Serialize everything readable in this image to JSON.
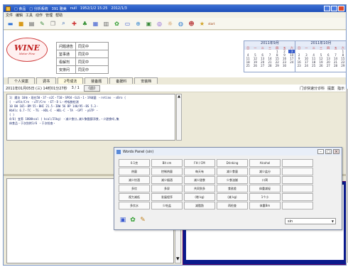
{
  "window": {
    "title_parts": [
      "□ 食品",
      "□ 分析系统",
      "391 雅美",
      "null",
      "1952/1/2 15:25",
      "2012/1/3"
    ]
  },
  "menu": [
    "文件",
    "编辑",
    "工具",
    "动作",
    "管理",
    "帮助"
  ],
  "toolbar": {
    "icons": [
      {
        "name": "open-icon",
        "glyph": "▬",
        "color": "#2b6fd6"
      },
      {
        "name": "save-icon",
        "glyph": "■",
        "color": "#d89a1a"
      },
      {
        "name": "print-icon",
        "glyph": "▤",
        "color": "#555555"
      },
      {
        "name": "edit-icon",
        "glyph": "✎",
        "color": "#3a8a3a"
      },
      {
        "name": "copy-icon",
        "glyph": "❐",
        "color": "#7a7a7a"
      },
      {
        "name": "search-icon",
        "glyph": "⌕",
        "color": "#2b5fb0"
      },
      {
        "name": "tools-icon",
        "glyph": "✚",
        "color": "#c33"
      },
      {
        "name": "bell-icon",
        "glyph": "♣",
        "color": "#2a8a2a"
      },
      {
        "name": "calendar-icon",
        "glyph": "▦",
        "color": "#3a5ad0"
      },
      {
        "name": "chart-icon",
        "glyph": "▥",
        "color": "#6a6a6a"
      },
      {
        "name": "flower-icon",
        "glyph": "✿",
        "color": "#2a9a2a"
      },
      {
        "name": "card-icon",
        "glyph": "▭",
        "color": "#3a5ad0"
      },
      {
        "name": "zoom-icon",
        "glyph": "⊕",
        "color": "#3a8ad0"
      },
      {
        "name": "image-icon",
        "glyph": "▣",
        "color": "#3a8a3a"
      },
      {
        "name": "cd-icon",
        "glyph": "◎",
        "color": "#7a4ad0"
      },
      {
        "name": "drum-icon",
        "glyph": "☼",
        "color": "#c07020"
      },
      {
        "name": "web-icon",
        "glyph": "◍",
        "color": "#2a7ad0"
      },
      {
        "name": "user-icon",
        "glyph": "☻",
        "color": "#c05050"
      },
      {
        "name": "start-icon",
        "glyph": "★",
        "color": "#d0a020"
      }
    ],
    "start_label": "start"
  },
  "logo": {
    "text": "WINE",
    "subtitle": "Meter Fine"
  },
  "info_grid": [
    {
      "label": "问题通告",
      "value": "同见中"
    },
    {
      "label": "鉴事通",
      "value": "同见中"
    },
    {
      "label": "看解剂",
      "value": "同见中"
    },
    {
      "label": "安排问",
      "value": "同见中"
    }
  ],
  "calendars": [
    {
      "title": "2011年9月",
      "dow": [
        "日",
        "一",
        "二",
        "三",
        "四",
        "五",
        "六"
      ],
      "days": [
        "",
        "",
        "",
        "",
        "1",
        "2",
        "3",
        "4",
        "5",
        "6",
        "7",
        "8",
        "9",
        "10",
        "11",
        "12",
        "13",
        "14",
        "15",
        "16",
        "17",
        "18",
        "19",
        "20",
        "21",
        "22",
        "23",
        "24",
        "25",
        "26",
        "27",
        "28",
        "29",
        "30",
        ""
      ],
      "selected": "3"
    },
    {
      "title": "2011年10月",
      "dow": [
        "日",
        "一",
        "二",
        "三",
        "四",
        "五",
        "六"
      ],
      "days": [
        "",
        "",
        "",
        "",
        "",
        "",
        "1",
        "2",
        "3",
        "4",
        "5",
        "6",
        "7",
        "8",
        "9",
        "10",
        "11",
        "12",
        "13",
        "14",
        "15",
        "16",
        "17",
        "18",
        "19",
        "20",
        "21",
        "22",
        "23",
        "24",
        "25",
        "26",
        "27",
        "28",
        "29"
      ],
      "selected": ""
    }
  ],
  "tabs": [
    {
      "label": "个人资案",
      "active": false
    },
    {
      "label": "调书",
      "active": false
    },
    {
      "label": "2号成法",
      "active": true
    },
    {
      "label": "装备题",
      "active": false
    },
    {
      "label": "备援料",
      "active": false
    },
    {
      "label": "安装档",
      "active": false
    }
  ],
  "datebar": {
    "date": "2011年01月05日 (三) 14时01分27秒",
    "page": "3 / 1",
    "nav_button": "《前》",
    "right_items": [
      "门诊快速分诊科",
      "提案",
      "指示"
    ]
  },
  "record_lines": [
    "1) 遭访 10年・现在50・37・o2C・T10・SPO4・GLS・1・19球菌 ・retino    ・sBro (",
    "( ・uAlk/Cre    ・uTF/Cre    ・ET・D L・呼吸数检测",
    "10 BH   165・BM   55・BHI    21.5・IBW    56 BP    140/95・BS 5.3・",
    "HbAlc 6.7・TC    ・TG   ・HDL-C    ・HDL-C    ・TA    ・GPT    ・yGTP    ・",
    "(   )",
    "4/6) 宜养    1800kcal (    kcal/25kg) ・减少食分,减少聚酯醇添食,・少甜食吗,集",
    "体食品・于次别附1/6    ・于次检查・"
  ],
  "words_panel": {
    "title": "Words Panel (sin)",
    "rows": [
      [
        "0.1克",
        "Bit cm",
        "FH / CM",
        "Drinking",
        "Alcohol",
        ""
      ],
      [
        "热量",
        "控制热量",
        "每天有",
        "减少食量",
        "减少盐分",
        ""
      ],
      [
        "减少饮酒",
        "减少烟酒",
        "减少甜食",
        "少食油腻",
        "口渴",
        ""
      ],
      [
        "多饮",
        "多尿",
        "共同到多",
        "食欲差",
        "体重减轻",
        ""
      ],
      [
        "视力减低",
        "发展程序",
        "(增 kg)",
        "(减 kg)",
        "1个小",
        ""
      ],
      [
        "多饮水",
        "少吃盐",
        "减脂肪",
        "再检查",
        "体重Bm",
        ""
      ]
    ],
    "select_value": "sin",
    "footer_icons": [
      "pen-icon",
      "flower-icon",
      "pencil-icon"
    ]
  }
}
